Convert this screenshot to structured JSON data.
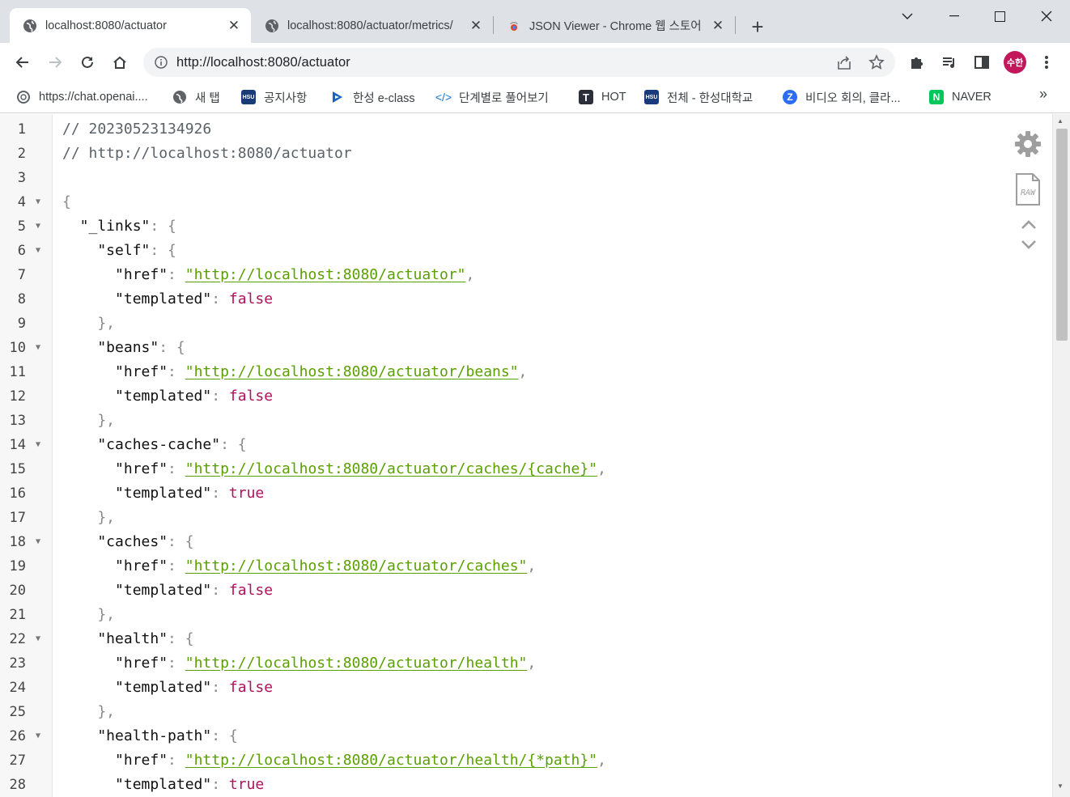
{
  "tabs": [
    {
      "title": "localhost:8080/actuator",
      "active": true
    },
    {
      "title": "localhost:8080/actuator/metrics/",
      "active": false
    },
    {
      "title": "JSON Viewer - Chrome 웹 스토어",
      "active": false
    }
  ],
  "omnibox": {
    "url": "http://localhost:8080/actuator"
  },
  "profile": {
    "initials": "수한"
  },
  "bookmarks": [
    {
      "label": "https://chat.openai....",
      "icon": "openai-icon"
    },
    {
      "label": "새 탭",
      "icon": "globe-icon"
    },
    {
      "label": "공지사항",
      "icon": "hansung-icon"
    },
    {
      "label": "한성 e-class",
      "icon": "eclass-icon"
    },
    {
      "label": "단계별로 풀어보기",
      "icon": "code-icon"
    },
    {
      "label": "HOT",
      "icon": "t-icon"
    },
    {
      "label": "전체 - 한성대학교",
      "icon": "hansung-icon"
    },
    {
      "label": "비디오 회의, 클라...",
      "icon": "zoom-icon"
    },
    {
      "label": "NAVER",
      "icon": "naver-icon"
    }
  ],
  "viewer": {
    "lines": [
      {
        "n": "1",
        "fold": false,
        "parts": [
          [
            "comment",
            "// 20230523134926"
          ]
        ]
      },
      {
        "n": "2",
        "fold": false,
        "parts": [
          [
            "comment",
            "// http://localhost:8080/actuator"
          ]
        ]
      },
      {
        "n": "3",
        "fold": false,
        "parts": []
      },
      {
        "n": "4",
        "fold": true,
        "parts": [
          [
            "punc",
            "{"
          ]
        ]
      },
      {
        "n": "5",
        "fold": true,
        "parts": [
          [
            "key",
            "  \"_links\""
          ],
          [
            "punc",
            ": {"
          ]
        ]
      },
      {
        "n": "6",
        "fold": true,
        "parts": [
          [
            "key",
            "    \"self\""
          ],
          [
            "punc",
            ": {"
          ]
        ]
      },
      {
        "n": "7",
        "fold": false,
        "parts": [
          [
            "key",
            "      \"href\""
          ],
          [
            "punc",
            ": "
          ],
          [
            "url",
            "\"http://localhost:8080/actuator\""
          ],
          [
            "punc",
            ","
          ]
        ]
      },
      {
        "n": "8",
        "fold": false,
        "parts": [
          [
            "key",
            "      \"templated\""
          ],
          [
            "punc",
            ": "
          ],
          [
            "false",
            "false"
          ]
        ]
      },
      {
        "n": "9",
        "fold": false,
        "parts": [
          [
            "punc",
            "    },"
          ]
        ]
      },
      {
        "n": "10",
        "fold": true,
        "parts": [
          [
            "key",
            "    \"beans\""
          ],
          [
            "punc",
            ": {"
          ]
        ]
      },
      {
        "n": "11",
        "fold": false,
        "parts": [
          [
            "key",
            "      \"href\""
          ],
          [
            "punc",
            ": "
          ],
          [
            "url",
            "\"http://localhost:8080/actuator/beans\""
          ],
          [
            "punc",
            ","
          ]
        ]
      },
      {
        "n": "12",
        "fold": false,
        "parts": [
          [
            "key",
            "      \"templated\""
          ],
          [
            "punc",
            ": "
          ],
          [
            "false",
            "false"
          ]
        ]
      },
      {
        "n": "13",
        "fold": false,
        "parts": [
          [
            "punc",
            "    },"
          ]
        ]
      },
      {
        "n": "14",
        "fold": true,
        "parts": [
          [
            "key",
            "    \"caches-cache\""
          ],
          [
            "punc",
            ": {"
          ]
        ]
      },
      {
        "n": "15",
        "fold": false,
        "parts": [
          [
            "key",
            "      \"href\""
          ],
          [
            "punc",
            ": "
          ],
          [
            "url",
            "\"http://localhost:8080/actuator/caches/{cache}\""
          ],
          [
            "punc",
            ","
          ]
        ]
      },
      {
        "n": "16",
        "fold": false,
        "parts": [
          [
            "key",
            "      \"templated\""
          ],
          [
            "punc",
            ": "
          ],
          [
            "true",
            "true"
          ]
        ]
      },
      {
        "n": "17",
        "fold": false,
        "parts": [
          [
            "punc",
            "    },"
          ]
        ]
      },
      {
        "n": "18",
        "fold": true,
        "parts": [
          [
            "key",
            "    \"caches\""
          ],
          [
            "punc",
            ": {"
          ]
        ]
      },
      {
        "n": "19",
        "fold": false,
        "parts": [
          [
            "key",
            "      \"href\""
          ],
          [
            "punc",
            ": "
          ],
          [
            "url",
            "\"http://localhost:8080/actuator/caches\""
          ],
          [
            "punc",
            ","
          ]
        ]
      },
      {
        "n": "20",
        "fold": false,
        "parts": [
          [
            "key",
            "      \"templated\""
          ],
          [
            "punc",
            ": "
          ],
          [
            "false",
            "false"
          ]
        ]
      },
      {
        "n": "21",
        "fold": false,
        "parts": [
          [
            "punc",
            "    },"
          ]
        ]
      },
      {
        "n": "22",
        "fold": true,
        "parts": [
          [
            "key",
            "    \"health\""
          ],
          [
            "punc",
            ": {"
          ]
        ]
      },
      {
        "n": "23",
        "fold": false,
        "parts": [
          [
            "key",
            "      \"href\""
          ],
          [
            "punc",
            ": "
          ],
          [
            "url",
            "\"http://localhost:8080/actuator/health\""
          ],
          [
            "punc",
            ","
          ]
        ]
      },
      {
        "n": "24",
        "fold": false,
        "parts": [
          [
            "key",
            "      \"templated\""
          ],
          [
            "punc",
            ": "
          ],
          [
            "false",
            "false"
          ]
        ]
      },
      {
        "n": "25",
        "fold": false,
        "parts": [
          [
            "punc",
            "    },"
          ]
        ]
      },
      {
        "n": "26",
        "fold": true,
        "parts": [
          [
            "key",
            "    \"health-path\""
          ],
          [
            "punc",
            ": {"
          ]
        ]
      },
      {
        "n": "27",
        "fold": false,
        "parts": [
          [
            "key",
            "      \"href\""
          ],
          [
            "punc",
            ": "
          ],
          [
            "url",
            "\"http://localhost:8080/actuator/health/{*path}\""
          ],
          [
            "punc",
            ","
          ]
        ]
      },
      {
        "n": "28",
        "fold": false,
        "parts": [
          [
            "key",
            "      \"templated\""
          ],
          [
            "punc",
            ": "
          ],
          [
            "true",
            "true"
          ]
        ]
      }
    ],
    "raw_label": "RAW"
  },
  "colors": {
    "tabstrip": "#dee1e6",
    "url_green": "#5aa000",
    "boolean": "#b0105e",
    "avatar": "#c2185b"
  }
}
